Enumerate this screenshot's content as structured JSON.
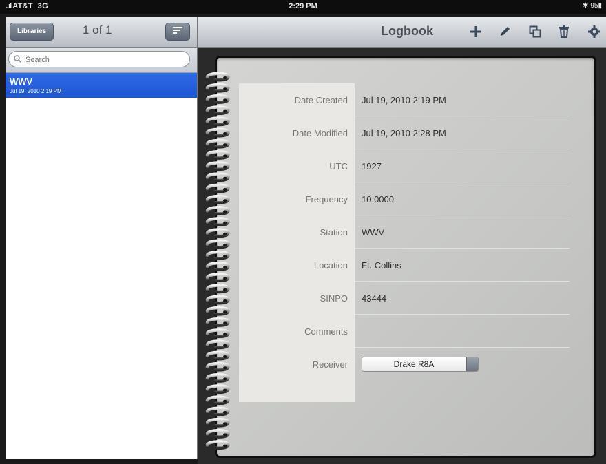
{
  "status_bar": {
    "carrier": "AT&T",
    "network": "3G",
    "time": "2:29 PM",
    "battery": "95"
  },
  "left_pane": {
    "libraries_button": "Libraries",
    "page_indicator": "1 of 1",
    "sort_icon": "sort-icon",
    "search_placeholder": "Search",
    "items": [
      {
        "title": "WWV",
        "subtitle": "Jul 19, 2010 2:19 PM",
        "selected": true
      }
    ]
  },
  "right_pane": {
    "title": "Logbook",
    "toolbar_icons": [
      "add-icon",
      "edit-icon",
      "duplicate-icon",
      "delete-icon",
      "settings-icon"
    ]
  },
  "record": {
    "fields": [
      {
        "label": "Date Created",
        "value": "Jul 19, 2010 2:19 PM"
      },
      {
        "label": "Date Modified",
        "value": "Jul 19, 2010 2:28 PM"
      },
      {
        "label": "UTC",
        "value": "1927"
      },
      {
        "label": "Frequency",
        "value": "10.0000"
      },
      {
        "label": "Station",
        "value": "WWV"
      },
      {
        "label": "Location",
        "value": "Ft. Collins"
      },
      {
        "label": "SINPO",
        "value": "43444"
      },
      {
        "label": "Comments",
        "value": ""
      },
      {
        "label": "Receiver",
        "value": "Drake R8A"
      }
    ]
  },
  "colors": {
    "selection_blue": "#2a62e0",
    "toolbar_gray": "#c9cdd2",
    "paper": "#cfd0ce"
  }
}
